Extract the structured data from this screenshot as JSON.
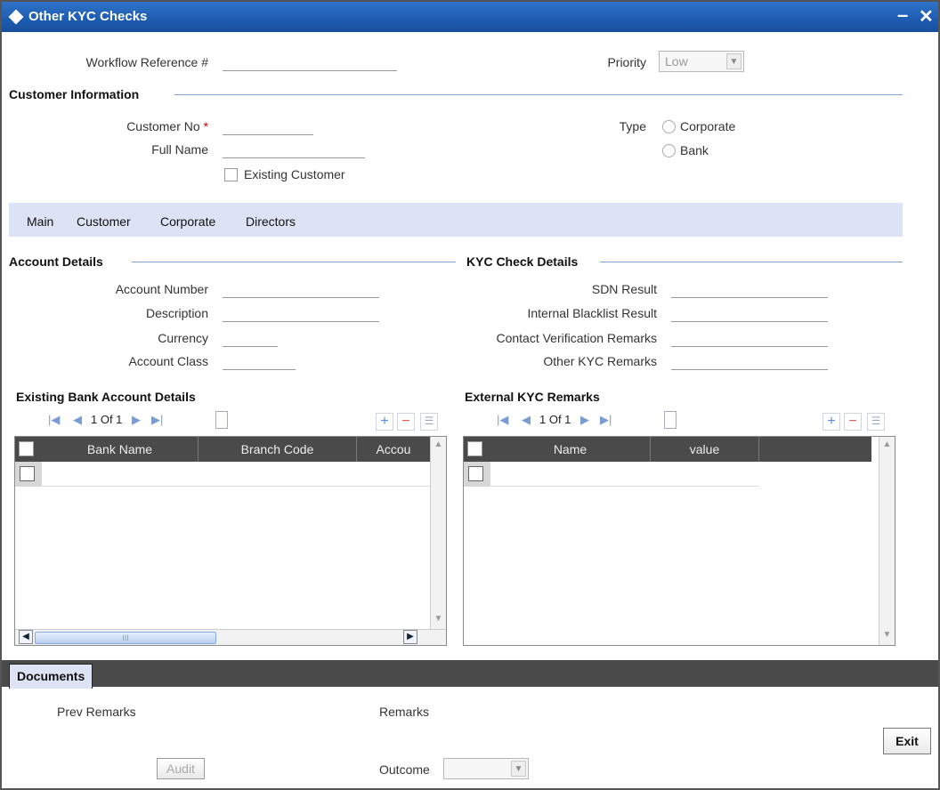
{
  "window": {
    "title": "Other KYC Checks",
    "minimize_symbol": "–",
    "close_symbol": "✕"
  },
  "header": {
    "workflow_label": "Workflow Reference #",
    "priority_label": "Priority",
    "priority_value": "Low"
  },
  "customer_info": {
    "section_title": "Customer Information",
    "customer_no_label": "Customer No",
    "required_mark": "*",
    "full_name_label": "Full Name",
    "existing_customer_label": "Existing Customer",
    "type_label": "Type",
    "type_options": [
      "Corporate",
      "Bank"
    ]
  },
  "tabs": [
    "Main",
    "Customer",
    "Corporate",
    "Directors"
  ],
  "account_details": {
    "section_title": "Account Details",
    "fields": [
      "Account Number",
      "Description",
      "Currency",
      "Account Class"
    ]
  },
  "kyc_check_details": {
    "section_title": "KYC Check Details",
    "fields": [
      "SDN Result",
      "Internal Blacklist Result",
      "Contact Verification Remarks",
      "Other KYC Remarks"
    ]
  },
  "existing_bank_accounts": {
    "section_title": "Existing Bank Account Details",
    "pager": "1 Of 1",
    "columns": [
      "Bank Name",
      "Branch Code",
      "Accou"
    ]
  },
  "external_kyc_remarks": {
    "section_title": "External KYC Remarks",
    "pager": "1 Of 1",
    "columns": [
      "Name",
      "value"
    ]
  },
  "footer": {
    "documents_tab": "Documents",
    "prev_remarks_label": "Prev Remarks",
    "remarks_label": "Remarks",
    "audit_button": "Audit",
    "outcome_label": "Outcome",
    "exit_button": "Exit"
  }
}
